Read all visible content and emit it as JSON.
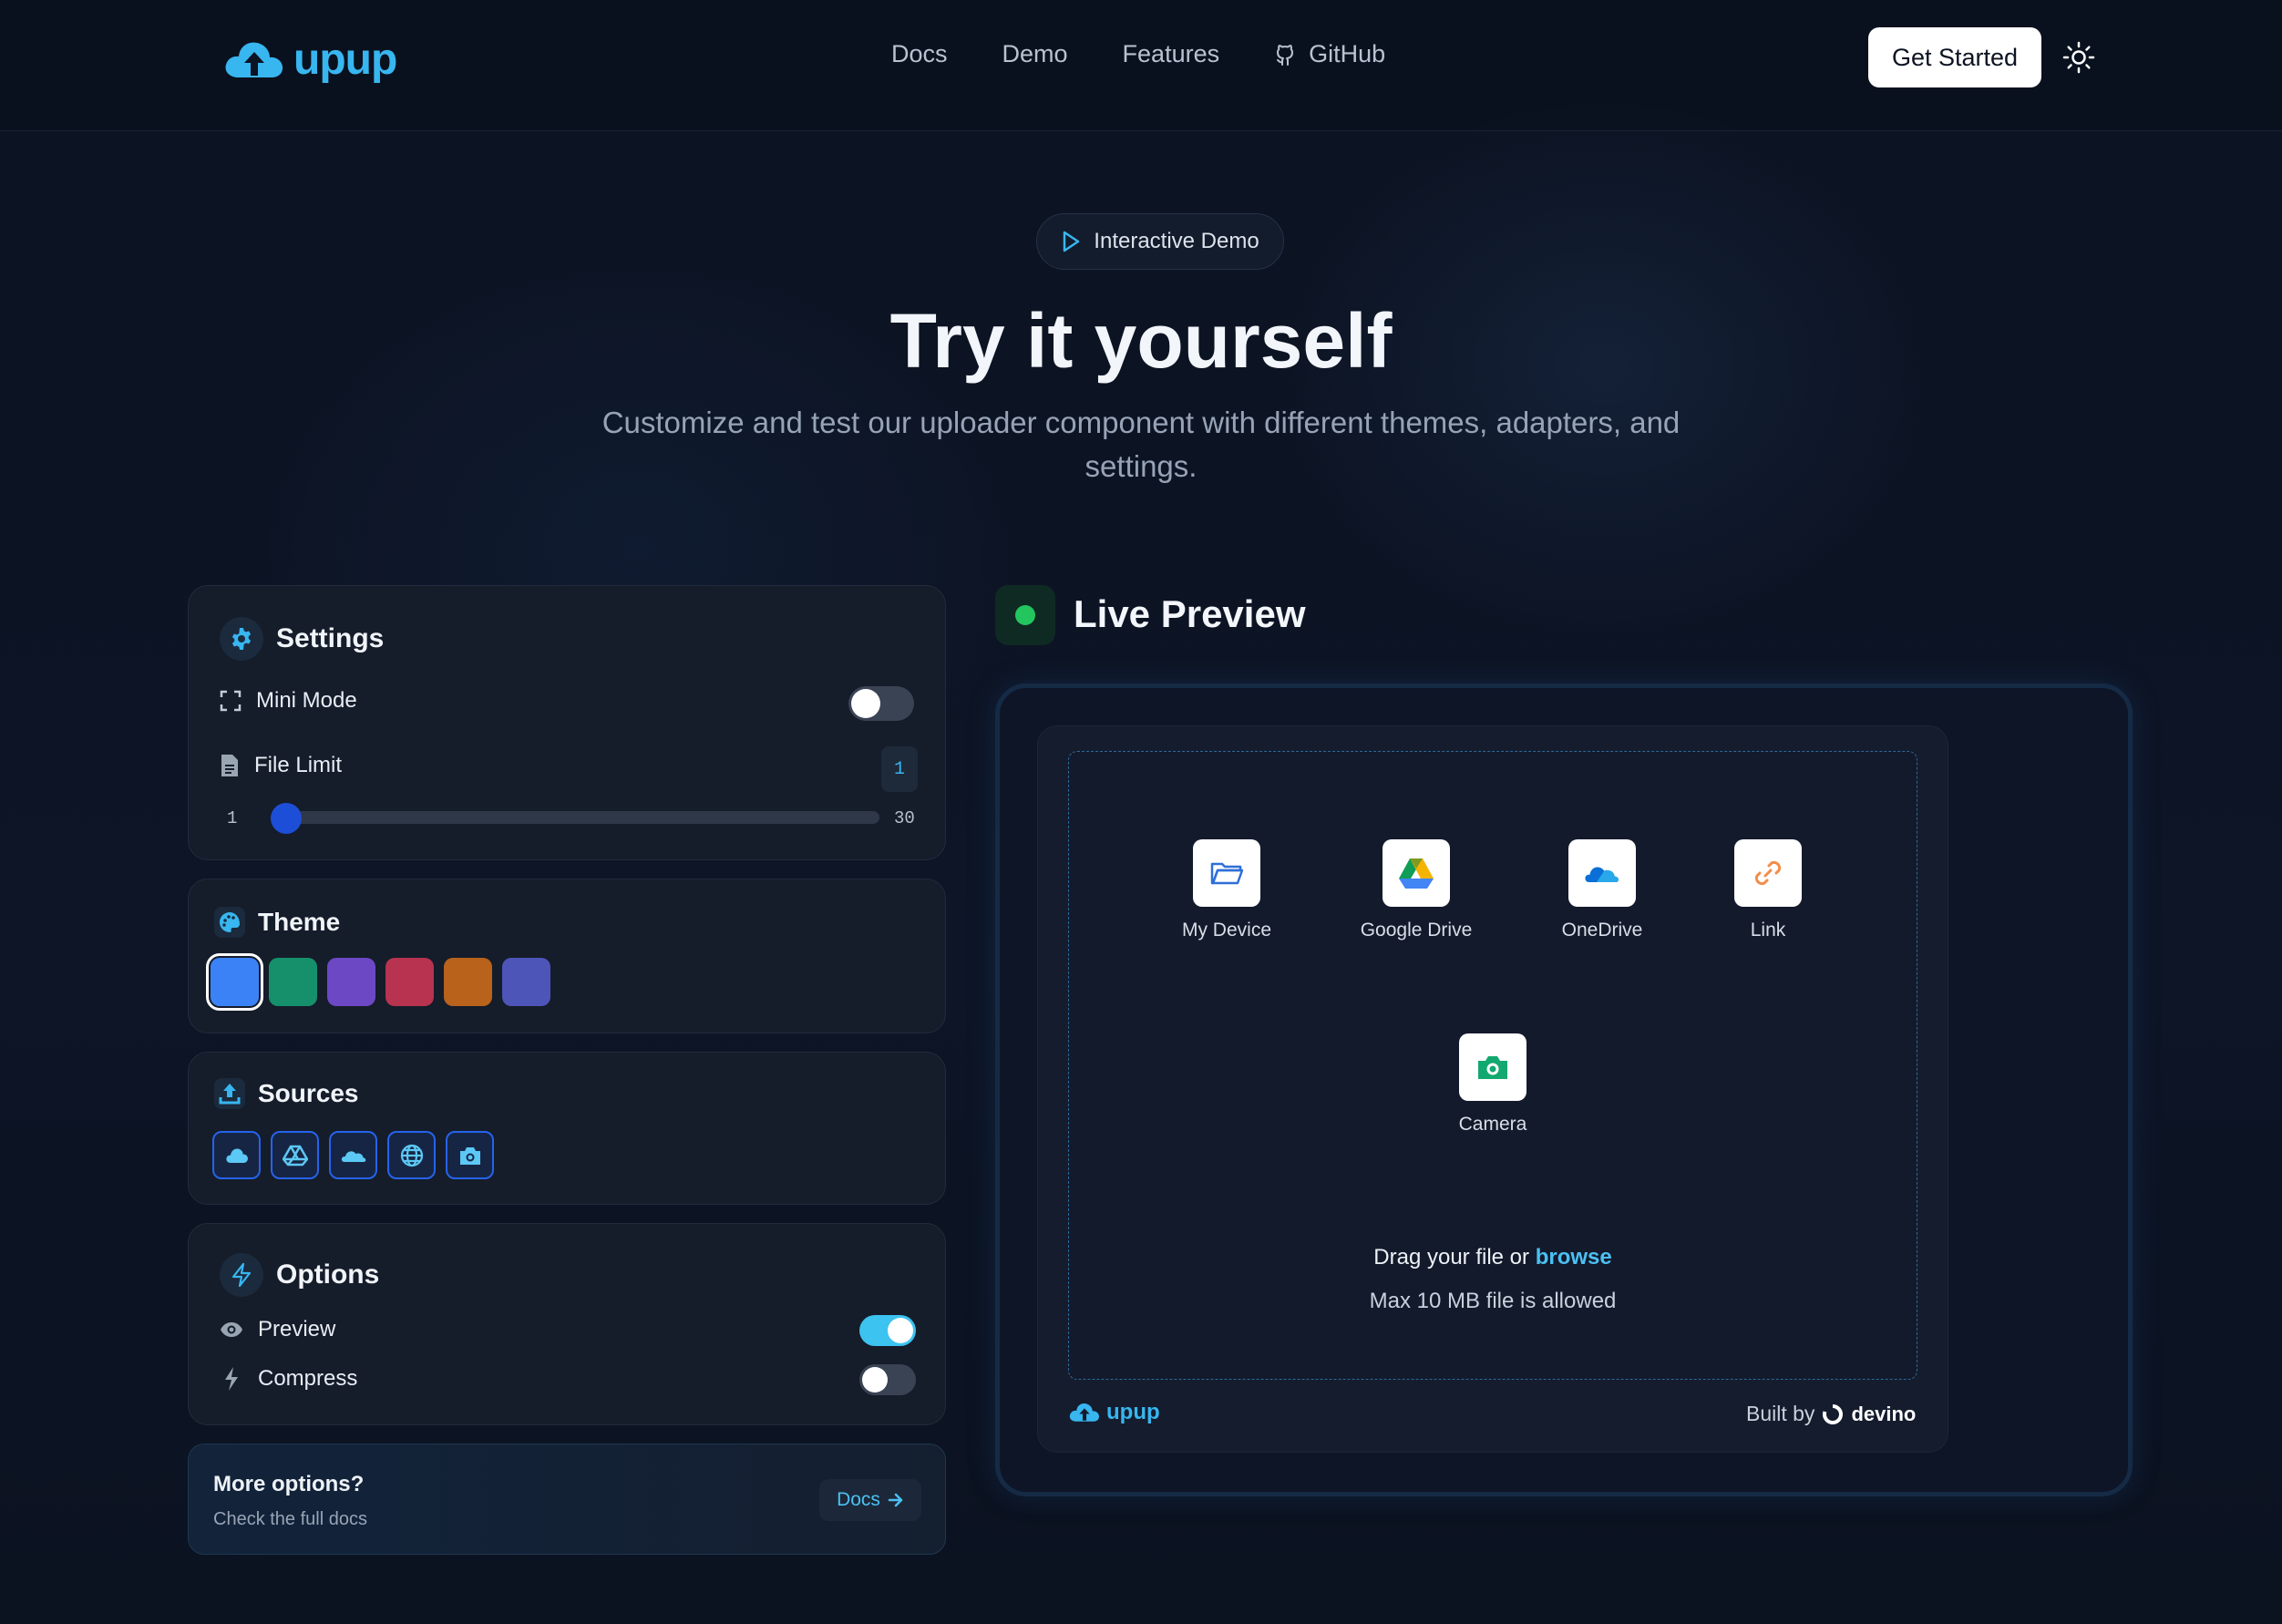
{
  "header": {
    "logo_text": "upup",
    "nav": [
      {
        "label": "Docs"
      },
      {
        "label": "Demo"
      },
      {
        "label": "Features"
      },
      {
        "label": "GitHub",
        "icon": "github-icon"
      }
    ],
    "cta_label": "Get Started",
    "theme_toggle_icon": "sun-icon"
  },
  "hero": {
    "badge_label": "Interactive Demo",
    "title": "Try it yourself",
    "subtitle": "Customize and test our uploader component with different themes, adapters, and settings."
  },
  "settings": {
    "title": "Settings",
    "mini_mode_label": "Mini Mode",
    "mini_mode_on": false,
    "file_limit_label": "File Limit",
    "file_limit_value": "1",
    "slider_min": "1",
    "slider_max": "30",
    "slider_value": 1
  },
  "theme": {
    "title": "Theme",
    "colors": [
      "#3b82f6",
      "#16906a",
      "#6d48c4",
      "#b7334f",
      "#b8621c",
      "#4d55b8"
    ],
    "selected_index": 0
  },
  "sources": {
    "title": "Sources",
    "items": [
      "cloud-icon",
      "google-drive-icon",
      "onedrive-icon",
      "globe-icon",
      "camera-icon"
    ]
  },
  "options": {
    "title": "Options",
    "preview_label": "Preview",
    "preview_on": true,
    "compress_label": "Compress",
    "compress_on": false
  },
  "more": {
    "title": "More options?",
    "subtitle": "Check the full docs",
    "button_label": "Docs"
  },
  "preview": {
    "title": "Live Preview",
    "adapters": [
      {
        "label": "My Device",
        "icon": "folder-icon"
      },
      {
        "label": "Google Drive",
        "icon": "google-drive-icon"
      },
      {
        "label": "OneDrive",
        "icon": "onedrive-icon"
      },
      {
        "label": "Link",
        "icon": "link-icon"
      },
      {
        "label": "Camera",
        "icon": "camera-icon"
      }
    ],
    "drag_text": "Drag your file or",
    "browse_text": "browse",
    "max_text": "Max 10 MB file is allowed",
    "footer_logo": "upup",
    "built_by": "Built by",
    "built_by_brand": "devino"
  },
  "colors": {
    "accent": "#38b6f0",
    "live": "#22c55e",
    "slider": "#1d4ed8"
  }
}
